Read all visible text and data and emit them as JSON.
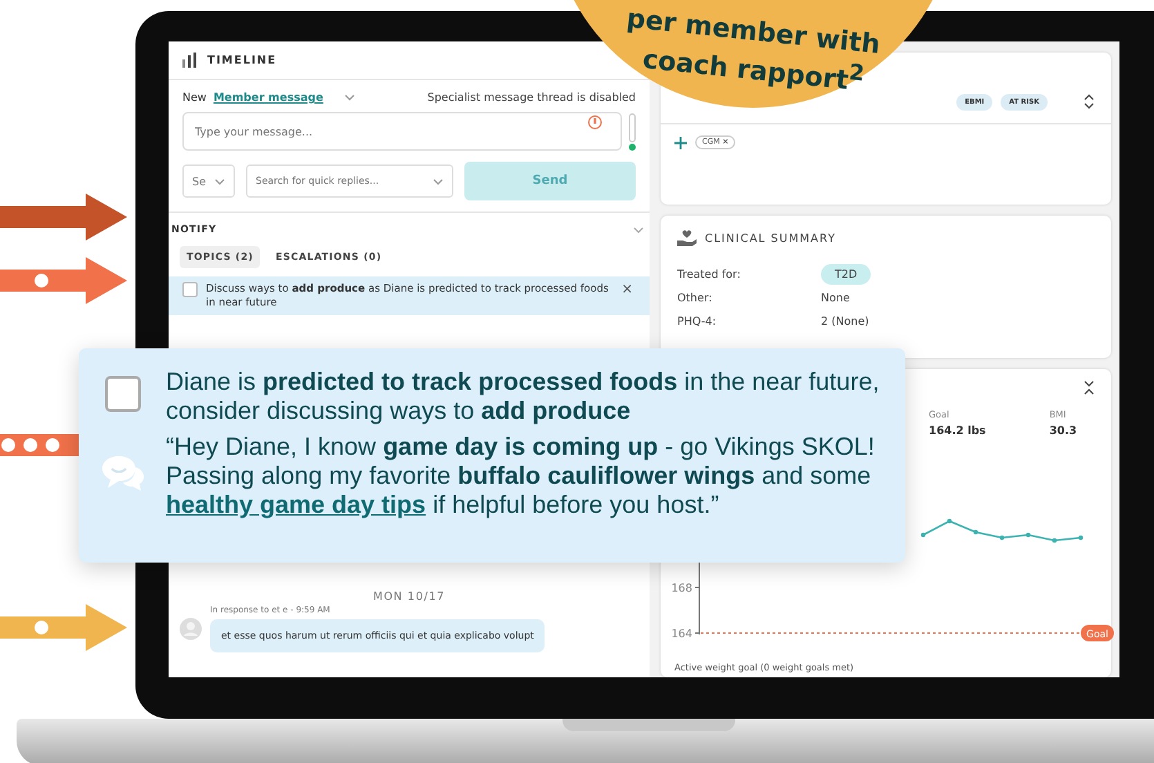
{
  "promo_circle": {
    "lines": [
      "per member with",
      "coach rapport$^{2}$"
    ]
  },
  "arrows": [
    {
      "color": "#c4532a",
      "kind": "plain"
    },
    {
      "color": "#f0714a",
      "kind": "one-dot"
    },
    {
      "color": "#f0714a",
      "kind": "three-dots"
    },
    {
      "color": "#f0b54f",
      "kind": "one-dot"
    }
  ],
  "timeline": {
    "title": "TIMELINE",
    "new_label": "New",
    "channel": "Member message",
    "specialist_note": "Specialist message thread is disabled",
    "message": {
      "placeholder": "Type your message..."
    },
    "select": {
      "placeholder": "Se"
    },
    "quick_replies": {
      "placeholder": "Search for quick replies..."
    },
    "send": {
      "label": "Send",
      "disabled": true
    },
    "notify": {
      "title": "NOTIFY",
      "tabs": [
        {
          "label": "TOPICS (2)",
          "selected": true
        },
        {
          "label": "ESCALATIONS (0)",
          "selected": false
        }
      ],
      "items": [
        {
          "text": "Discuss ways to **add produce** as Diane is predicted to track processed foods in near future",
          "checked": false,
          "close": "×"
        }
      ]
    },
    "day": "MON 10/17",
    "messages": [
      {
        "meta": "In response to et e - 9:59 AM",
        "text": "et esse quos harum ut rerum officiis qui et quia explicabo volupt"
      }
    ]
  },
  "profile": {
    "badges": [
      "EBMI",
      "AT RISK"
    ],
    "tags": [
      {
        "label": "CGM",
        "remove": "×"
      }
    ]
  },
  "clinical_summary": {
    "title": "CLINICAL SUMMARY",
    "rows": [
      {
        "label": "Treated for:",
        "value": "T2D",
        "kind": "chip"
      },
      {
        "label": "Other:",
        "value": "None",
        "kind": "text"
      },
      {
        "label": "PHQ-4:",
        "value": "2 (None)",
        "kind": "text"
      }
    ]
  },
  "weight": {
    "stats": [
      {
        "label": "Goal",
        "value": "164.2 lbs"
      },
      {
        "label": "BMI",
        "value": "30.3"
      }
    ],
    "y_tick_labels": [
      "168",
      "164"
    ],
    "goal_badge": "Goal",
    "footer": "Active weight goal (0 weight goals met)"
  },
  "callout": {
    "checked": false,
    "insight": "Diane is **predicted to track processed foods** in the near future, consider discussing ways to **add produce**",
    "message_before": "“Hey Diane, I know **game day is coming up** - go Vikings SKOL! Passing along my favorite **buffalo cauliflower wings** and some",
    "link": "healthy game day tips",
    "message_after": "if helpful before you host.”"
  }
}
